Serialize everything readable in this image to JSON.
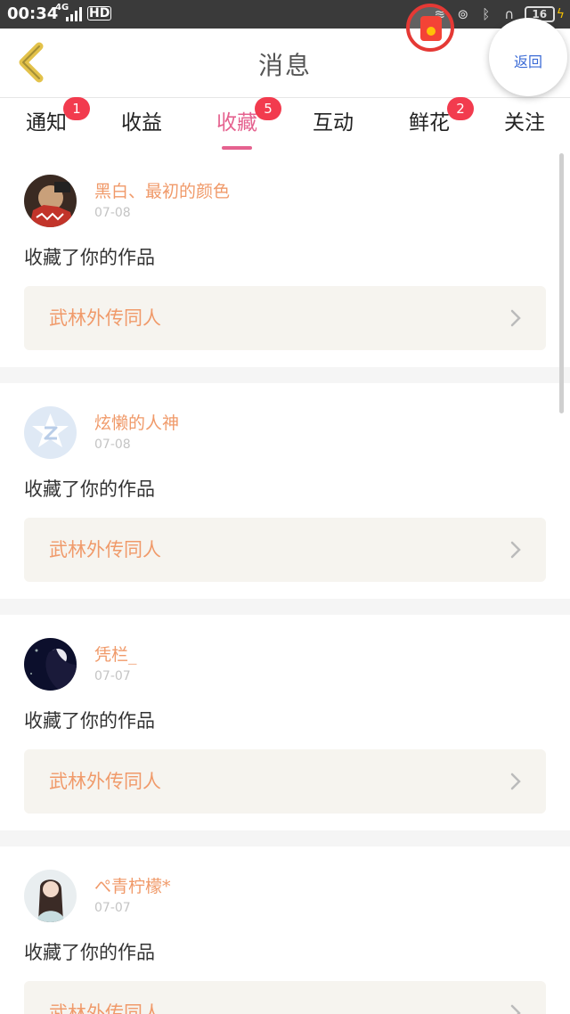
{
  "status_bar": {
    "time": "00:34",
    "network": "4G",
    "hd": "HD",
    "battery": "16"
  },
  "header": {
    "title": "消息",
    "return_label": "返回"
  },
  "tabs": [
    {
      "label": "通知",
      "badge": "1"
    },
    {
      "label": "收益",
      "badge": ""
    },
    {
      "label": "收藏",
      "badge": "5",
      "active": true
    },
    {
      "label": "互动",
      "badge": ""
    },
    {
      "label": "鲜花",
      "badge": "2"
    },
    {
      "label": "关注",
      "badge": ""
    }
  ],
  "messages": [
    {
      "user": "黑白、最初的颜色",
      "date": "07-08",
      "action": "收藏了你的作品",
      "work": "武林外传同人"
    },
    {
      "user": "炫懒的人神",
      "date": "07-08",
      "action": "收藏了你的作品",
      "work": "武林外传同人"
    },
    {
      "user": "凭栏_",
      "date": "07-07",
      "action": "收藏了你的作品",
      "work": "武林外传同人"
    },
    {
      "user": "ぺ青柠檬*",
      "date": "07-07",
      "action": "收藏了你的作品",
      "work": "武林外传同人"
    }
  ],
  "colors": {
    "accent": "#e5628f",
    "username": "#f09a6a",
    "badge": "#f23b4e"
  }
}
